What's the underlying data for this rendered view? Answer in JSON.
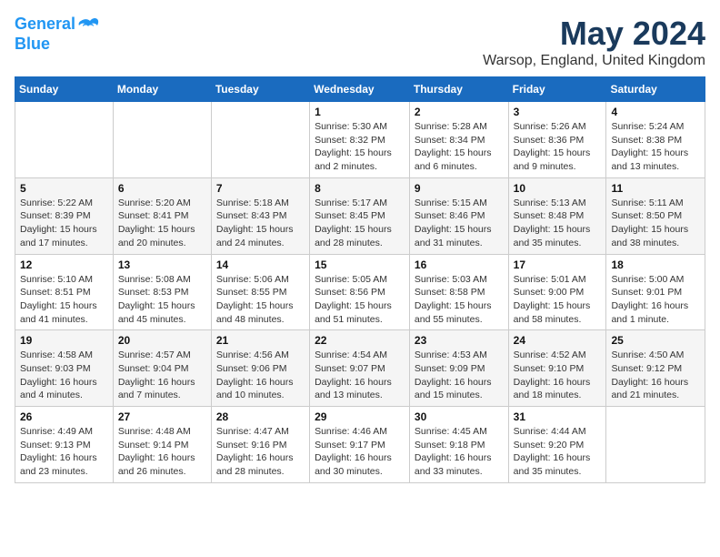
{
  "logo": {
    "line1": "General",
    "line2": "Blue"
  },
  "title": "May 2024",
  "location": "Warsop, England, United Kingdom",
  "days_of_week": [
    "Sunday",
    "Monday",
    "Tuesday",
    "Wednesday",
    "Thursday",
    "Friday",
    "Saturday"
  ],
  "weeks": [
    [
      {
        "day": "",
        "info": ""
      },
      {
        "day": "",
        "info": ""
      },
      {
        "day": "",
        "info": ""
      },
      {
        "day": "1",
        "info": "Sunrise: 5:30 AM\nSunset: 8:32 PM\nDaylight: 15 hours\nand 2 minutes."
      },
      {
        "day": "2",
        "info": "Sunrise: 5:28 AM\nSunset: 8:34 PM\nDaylight: 15 hours\nand 6 minutes."
      },
      {
        "day": "3",
        "info": "Sunrise: 5:26 AM\nSunset: 8:36 PM\nDaylight: 15 hours\nand 9 minutes."
      },
      {
        "day": "4",
        "info": "Sunrise: 5:24 AM\nSunset: 8:38 PM\nDaylight: 15 hours\nand 13 minutes."
      }
    ],
    [
      {
        "day": "5",
        "info": "Sunrise: 5:22 AM\nSunset: 8:39 PM\nDaylight: 15 hours\nand 17 minutes."
      },
      {
        "day": "6",
        "info": "Sunrise: 5:20 AM\nSunset: 8:41 PM\nDaylight: 15 hours\nand 20 minutes."
      },
      {
        "day": "7",
        "info": "Sunrise: 5:18 AM\nSunset: 8:43 PM\nDaylight: 15 hours\nand 24 minutes."
      },
      {
        "day": "8",
        "info": "Sunrise: 5:17 AM\nSunset: 8:45 PM\nDaylight: 15 hours\nand 28 minutes."
      },
      {
        "day": "9",
        "info": "Sunrise: 5:15 AM\nSunset: 8:46 PM\nDaylight: 15 hours\nand 31 minutes."
      },
      {
        "day": "10",
        "info": "Sunrise: 5:13 AM\nSunset: 8:48 PM\nDaylight: 15 hours\nand 35 minutes."
      },
      {
        "day": "11",
        "info": "Sunrise: 5:11 AM\nSunset: 8:50 PM\nDaylight: 15 hours\nand 38 minutes."
      }
    ],
    [
      {
        "day": "12",
        "info": "Sunrise: 5:10 AM\nSunset: 8:51 PM\nDaylight: 15 hours\nand 41 minutes."
      },
      {
        "day": "13",
        "info": "Sunrise: 5:08 AM\nSunset: 8:53 PM\nDaylight: 15 hours\nand 45 minutes."
      },
      {
        "day": "14",
        "info": "Sunrise: 5:06 AM\nSunset: 8:55 PM\nDaylight: 15 hours\nand 48 minutes."
      },
      {
        "day": "15",
        "info": "Sunrise: 5:05 AM\nSunset: 8:56 PM\nDaylight: 15 hours\nand 51 minutes."
      },
      {
        "day": "16",
        "info": "Sunrise: 5:03 AM\nSunset: 8:58 PM\nDaylight: 15 hours\nand 55 minutes."
      },
      {
        "day": "17",
        "info": "Sunrise: 5:01 AM\nSunset: 9:00 PM\nDaylight: 15 hours\nand 58 minutes."
      },
      {
        "day": "18",
        "info": "Sunrise: 5:00 AM\nSunset: 9:01 PM\nDaylight: 16 hours\nand 1 minute."
      }
    ],
    [
      {
        "day": "19",
        "info": "Sunrise: 4:58 AM\nSunset: 9:03 PM\nDaylight: 16 hours\nand 4 minutes."
      },
      {
        "day": "20",
        "info": "Sunrise: 4:57 AM\nSunset: 9:04 PM\nDaylight: 16 hours\nand 7 minutes."
      },
      {
        "day": "21",
        "info": "Sunrise: 4:56 AM\nSunset: 9:06 PM\nDaylight: 16 hours\nand 10 minutes."
      },
      {
        "day": "22",
        "info": "Sunrise: 4:54 AM\nSunset: 9:07 PM\nDaylight: 16 hours\nand 13 minutes."
      },
      {
        "day": "23",
        "info": "Sunrise: 4:53 AM\nSunset: 9:09 PM\nDaylight: 16 hours\nand 15 minutes."
      },
      {
        "day": "24",
        "info": "Sunrise: 4:52 AM\nSunset: 9:10 PM\nDaylight: 16 hours\nand 18 minutes."
      },
      {
        "day": "25",
        "info": "Sunrise: 4:50 AM\nSunset: 9:12 PM\nDaylight: 16 hours\nand 21 minutes."
      }
    ],
    [
      {
        "day": "26",
        "info": "Sunrise: 4:49 AM\nSunset: 9:13 PM\nDaylight: 16 hours\nand 23 minutes."
      },
      {
        "day": "27",
        "info": "Sunrise: 4:48 AM\nSunset: 9:14 PM\nDaylight: 16 hours\nand 26 minutes."
      },
      {
        "day": "28",
        "info": "Sunrise: 4:47 AM\nSunset: 9:16 PM\nDaylight: 16 hours\nand 28 minutes."
      },
      {
        "day": "29",
        "info": "Sunrise: 4:46 AM\nSunset: 9:17 PM\nDaylight: 16 hours\nand 30 minutes."
      },
      {
        "day": "30",
        "info": "Sunrise: 4:45 AM\nSunset: 9:18 PM\nDaylight: 16 hours\nand 33 minutes."
      },
      {
        "day": "31",
        "info": "Sunrise: 4:44 AM\nSunset: 9:20 PM\nDaylight: 16 hours\nand 35 minutes."
      },
      {
        "day": "",
        "info": ""
      }
    ]
  ]
}
